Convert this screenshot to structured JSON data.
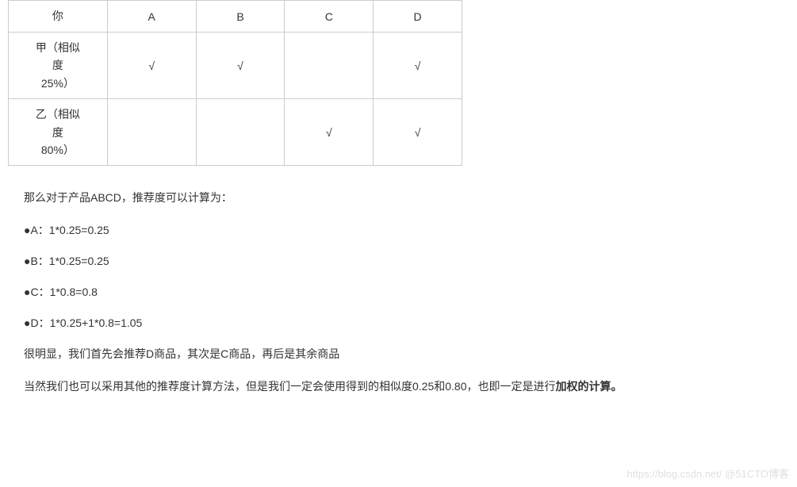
{
  "table": {
    "headers": [
      "你",
      "A",
      "B",
      "C",
      "D"
    ],
    "rows": [
      {
        "label_line1": "甲（相似",
        "label_line2": "度",
        "label_line3": "25%）",
        "values": [
          "√",
          "√",
          "",
          "√"
        ]
      },
      {
        "label_line1": "乙（相似",
        "label_line2": "度",
        "label_line3": "80%）",
        "values": [
          "",
          "",
          "√",
          "√"
        ]
      }
    ]
  },
  "content": {
    "intro": "那么对于产品ABCD，推荐度可以计算为：",
    "items": [
      "●A：1*0.25=0.25",
      "●B：1*0.25=0.25",
      "●C：1*0.8=0.8",
      "●D：1*0.25+1*0.8=1.05"
    ],
    "conclusion1": "很明显，我们首先会推荐D商品，其次是C商品，再后是其余商品",
    "conclusion2_part1": "当然我们也可以采用其他的推荐度计算方法，但是我们一定会使用得到的相似度0.25和0.80，也即一定是进行",
    "conclusion2_bold": "加权的计算。"
  },
  "watermark": "https://blog.csdn.net/ @51CTO博客"
}
